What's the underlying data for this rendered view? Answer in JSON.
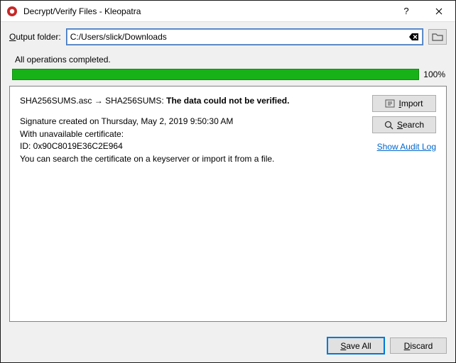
{
  "window": {
    "title": "Decrypt/Verify Files - Kleopatra"
  },
  "output": {
    "label": "Output folder:",
    "path": "C:/Users/slick/Downloads"
  },
  "status": {
    "message": "All operations completed.",
    "progress_percent": "100%"
  },
  "result": {
    "file_from": "SHA256SUMS.asc",
    "arrow": "→",
    "file_to": "SHA256SUMS:",
    "verdict": "The data could not be verified.",
    "sig_created": "Signature created on Thursday, May 2, 2019 9:50:30 AM",
    "cert_unavailable": "With unavailable certificate:",
    "cert_id": "ID: 0x90C8019E36C2E964",
    "search_hint": "You can search the certificate on a keyserver or import it from a file."
  },
  "buttons": {
    "import": "Import",
    "search": "Search",
    "audit": "Show Audit Log",
    "save_all": "Save All",
    "discard": "Discard"
  }
}
